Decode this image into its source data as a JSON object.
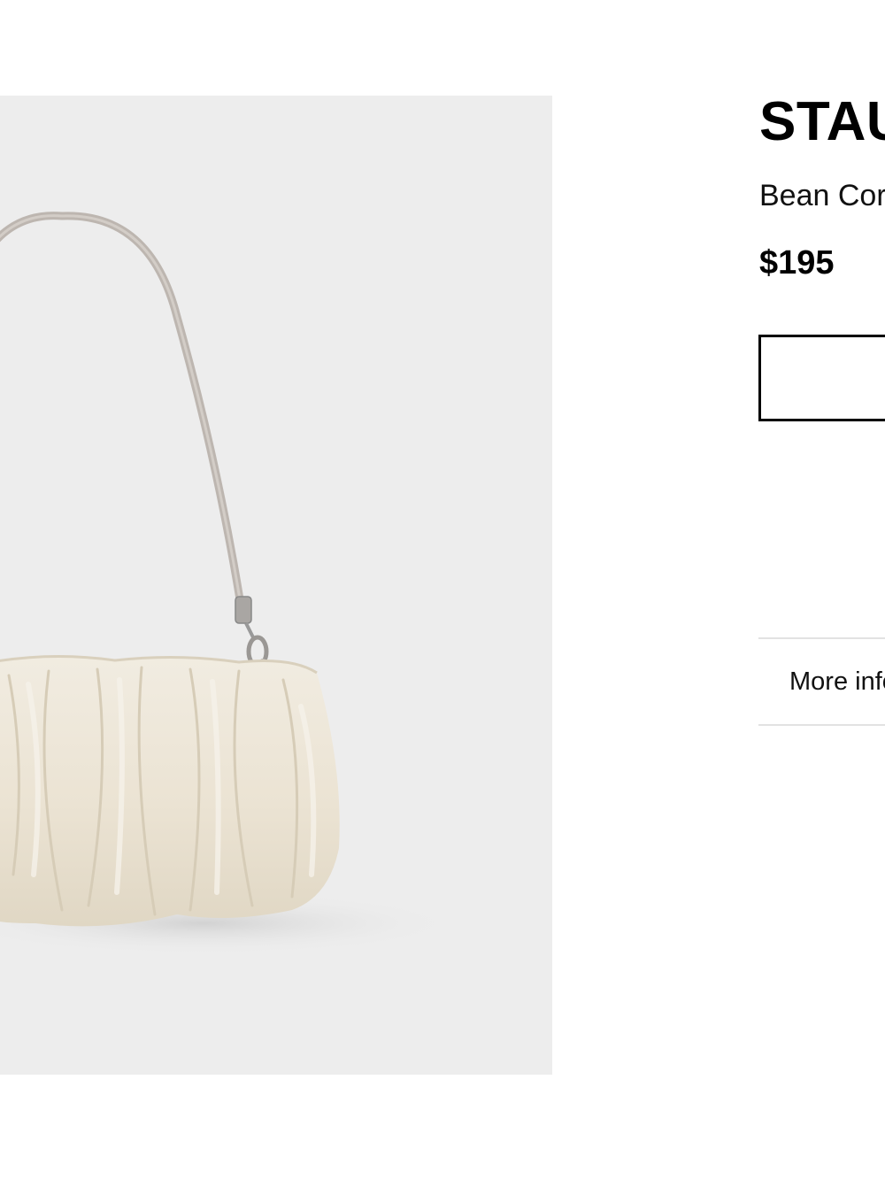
{
  "product": {
    "brand": "STAU",
    "name": "Bean Cor",
    "price": "$195",
    "image": {
      "subject": "bag-image",
      "background_color": "#ededed",
      "bag_color": "#ece5d6",
      "strap_color": "#bdb6b0"
    }
  },
  "accordion": {
    "more_info_label": "More info"
  },
  "colors": {
    "text": "#000000",
    "divider": "#e2e2e2",
    "background": "#ffffff"
  }
}
